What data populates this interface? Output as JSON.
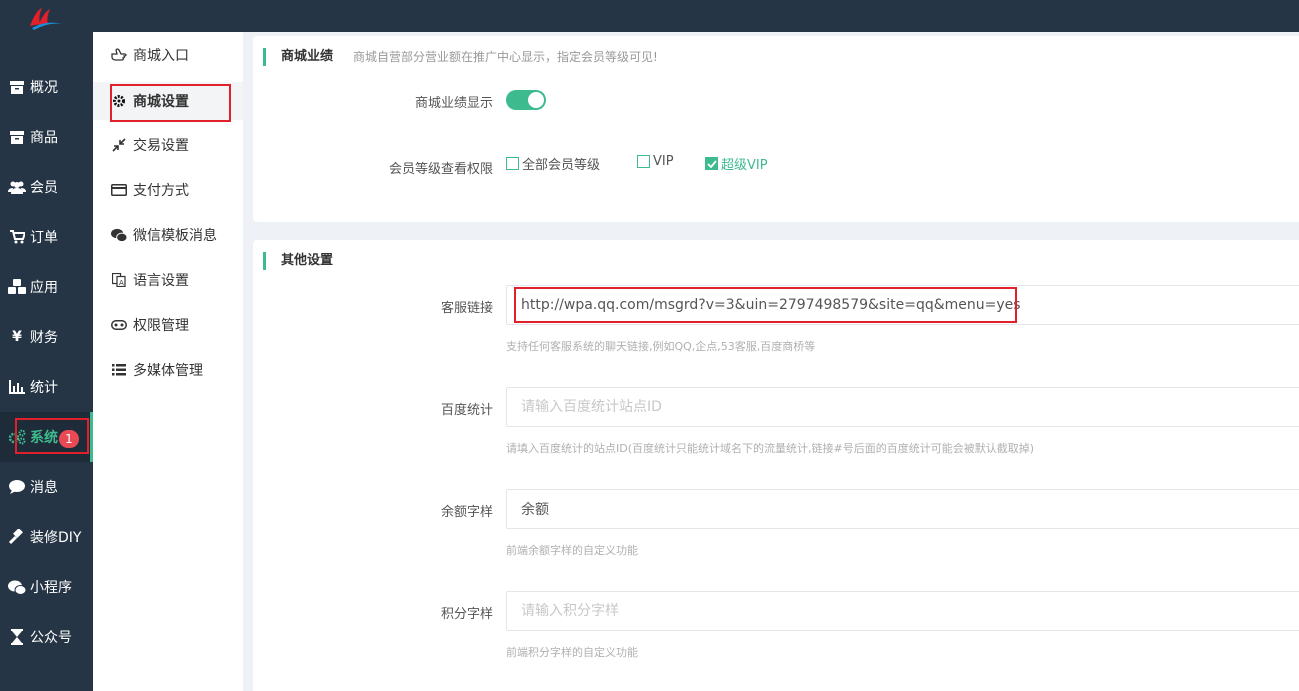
{
  "sidebar": {
    "items": [
      {
        "label": "概况",
        "icon": "archive-icon"
      },
      {
        "label": "商品",
        "icon": "archive-icon"
      },
      {
        "label": "会员",
        "icon": "users-icon"
      },
      {
        "label": "订单",
        "icon": "cart-icon"
      },
      {
        "label": "应用",
        "icon": "cubes-icon"
      },
      {
        "label": "财务",
        "icon": "yen-icon"
      },
      {
        "label": "统计",
        "icon": "bar-chart-icon"
      },
      {
        "label": "系统",
        "icon": "gears-icon"
      },
      {
        "label": "消息",
        "icon": "comment-icon"
      },
      {
        "label": "装修DIY",
        "icon": "gavel-icon"
      },
      {
        "label": "小程序",
        "icon": "wechat-icon"
      },
      {
        "label": "公众号",
        "icon": "hourglass-icon"
      }
    ],
    "message_badge": "1"
  },
  "submenu": {
    "items": [
      {
        "label": "商城入口",
        "icon": "hand-point-icon"
      },
      {
        "label": "商城设置",
        "icon": "gear-icon"
      },
      {
        "label": "交易设置",
        "icon": "compress-icon"
      },
      {
        "label": "支付方式",
        "icon": "credit-card-icon"
      },
      {
        "label": "微信模板消息",
        "icon": "wechat-icon"
      },
      {
        "label": "语言设置",
        "icon": "language-icon"
      },
      {
        "label": "权限管理",
        "icon": "gamepad-icon"
      },
      {
        "label": "多媒体管理",
        "icon": "list-icon"
      }
    ]
  },
  "performance": {
    "title": "商城业绩",
    "desc": "商城自营部分营业额在推广中心显示，指定会员等级可见!",
    "display_label": "商城业绩显示",
    "display_on": true,
    "level_label": "会员等级查看权限",
    "levels": [
      {
        "label": "全部会员等级",
        "checked": false
      },
      {
        "label": "VIP",
        "checked": false
      },
      {
        "label": "超级VIP",
        "checked": true
      }
    ]
  },
  "other": {
    "title": "其他设置",
    "service_label": "客服链接",
    "service_value": "http://wpa.qq.com/msgrd?v=3&uin=2797498579&site=qq&menu=yes",
    "service_help": "支持任何客服系统的聊天链接,例如QQ,企点,53客服,百度商桥等",
    "baidu_label": "百度统计",
    "baidu_placeholder": "请输入百度统计站点ID",
    "baidu_help": "请填入百度统计的站点ID(百度统计只能统计域名下的流量统计,链接#号后面的百度统计可能会被默认截取掉)",
    "balance_label": "余额字样",
    "balance_value": "余额",
    "balance_help": "前端余额字样的自定义功能",
    "points_label": "积分字样",
    "points_placeholder": "请输入积分字样",
    "points_help": "前端积分字样的自定义功能"
  },
  "colors": {
    "accent": "#3dbb8e",
    "sidebar_bg": "#263545",
    "highlight": "#e0202a",
    "badge": "#e84a55"
  }
}
